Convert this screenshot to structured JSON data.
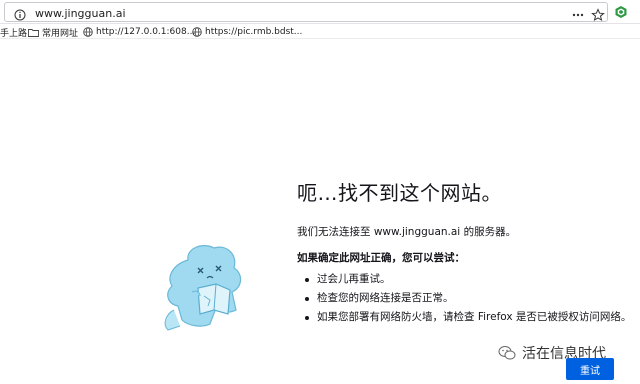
{
  "browser": {
    "url": "www.jingguan.ai",
    "icons": [
      "info-icon",
      "more-dots-icon",
      "star-icon",
      "extension-icon"
    ]
  },
  "bookmarks": {
    "items": [
      {
        "label": "手上路",
        "icon": ""
      },
      {
        "label": "常用网址",
        "icon": "folder-icon"
      },
      {
        "label": "http://127.0.0.1:608...",
        "icon": "globe-icon"
      },
      {
        "label": "https://pic.rmb.bdst...",
        "icon": "globe-icon"
      }
    ]
  },
  "error": {
    "title": "呃…找不到这个网站。",
    "description": "我们无法连接至 www.jingguan.ai 的服务器。",
    "try_heading": "如果确定此网址正确，您可以尝试：",
    "tips": [
      "过会儿再重试。",
      "检查您的网络连接是否正常。",
      "如果您部署有网络防火墙，请检查 Firefox 是否已被授权访问网络。"
    ],
    "retry_label": "重试"
  },
  "watermark": {
    "text": "活在信息时代"
  },
  "colors": {
    "accent": "#0061e0",
    "mascot": "#8fd3ee"
  }
}
